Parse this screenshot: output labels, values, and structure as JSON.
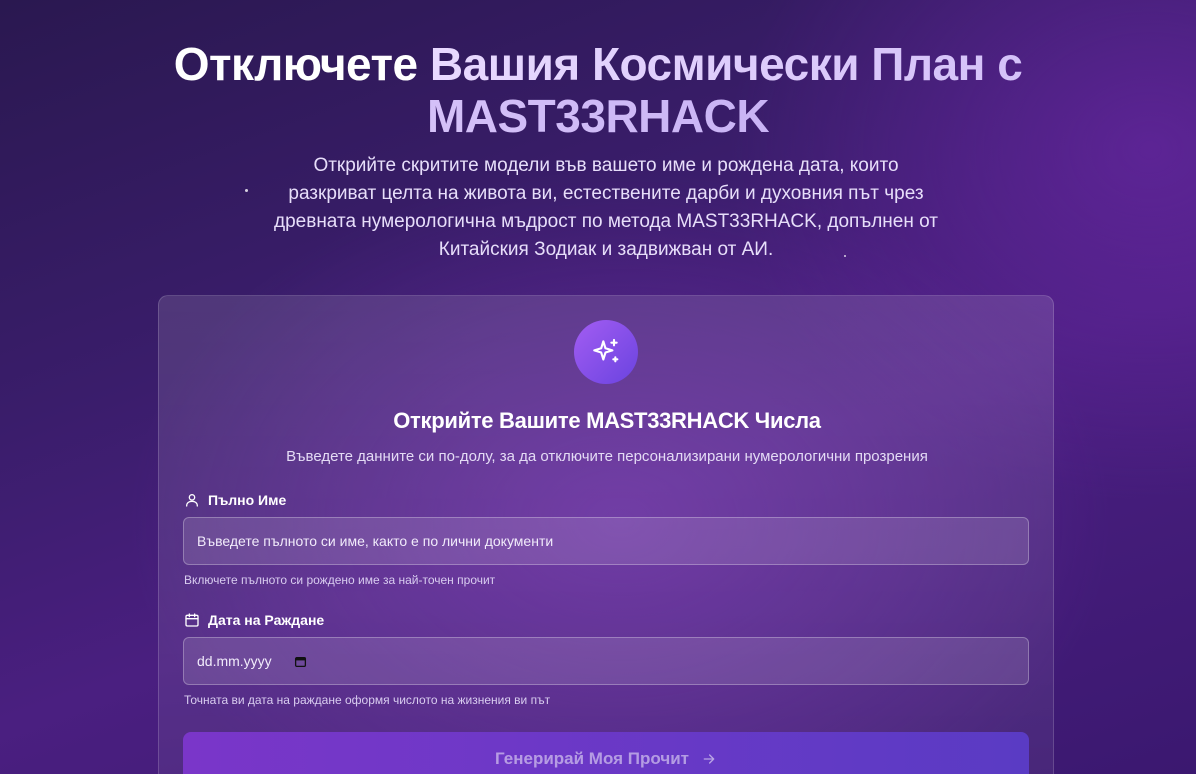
{
  "hero": {
    "title_part1": "Отключете ",
    "title_part2": "Вашия Космически План с MAST33RHACK",
    "subtitle": "Открийте скритите модели във вашето име и рождена дата, които разкриват целта на живота ви, естествените дарби и духовния път чрез древната нумерологична мъдрост по метода MAST33RHACK, допълнен от Китайския Зодиак и задвижван от АИ."
  },
  "form": {
    "badge_icon": "sparkles-icon",
    "title": "Открийте Вашите MAST33RHACK Числа",
    "subtitle": "Въведете данните си по-долу, за да отключите персонализирани нумерологични прозрения",
    "name_field": {
      "icon": "user-icon",
      "label": "Пълно Име",
      "placeholder": "Въведете пълното си име, както е по лични документи",
      "hint": "Включете пълното си рождено име за най-точен прочит"
    },
    "date_field": {
      "icon": "calendar-icon",
      "label": "Дата на Раждане",
      "placeholder": "dd.mm.yyyy",
      "hint": "Точната ви дата на раждане оформя числото на жизнения ви път"
    },
    "submit_label": "Генерирай Моя Прочит",
    "submit_icon": "arrow-right-icon"
  },
  "colors": {
    "accent_start": "#a35df2",
    "accent_end": "#6a43e0"
  }
}
